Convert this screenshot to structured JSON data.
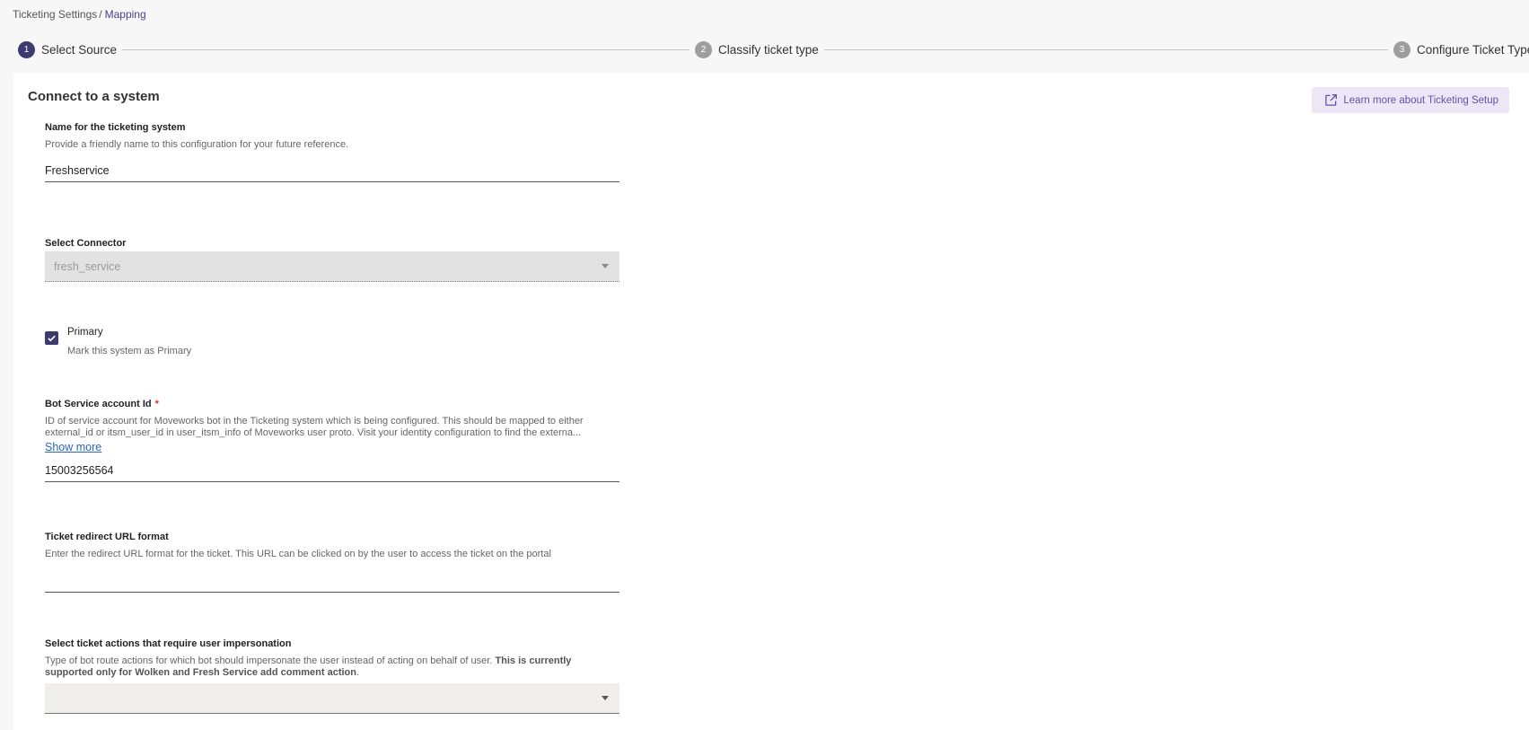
{
  "breadcrumb": {
    "parent": "Ticketing Settings",
    "separator": "/",
    "current": "Mapping"
  },
  "stepper": {
    "steps": [
      {
        "number": "1",
        "label": "Select Source",
        "active": true
      },
      {
        "number": "2",
        "label": "Classify ticket type",
        "active": false
      },
      {
        "number": "3",
        "label": "Configure Ticket Type",
        "active": false
      }
    ]
  },
  "card": {
    "title": "Connect to a system",
    "learn_more": {
      "label": "Learn more about Ticketing Setup",
      "icon": "external-link-icon"
    }
  },
  "fields": {
    "name": {
      "label": "Name for the ticketing system",
      "help": "Provide a friendly name to this configuration for your future reference.",
      "value": "Freshservice"
    },
    "connector": {
      "label": "Select Connector",
      "value": "fresh_service",
      "disabled": true
    },
    "primary": {
      "label": "Primary",
      "help": "Mark this system as Primary",
      "checked": true
    },
    "bot_account": {
      "label": "Bot Service account Id",
      "required_mark": "*",
      "help": "ID of service account for Moveworks bot in the Ticketing system which is being configured. This should be mapped to either external_id or itsm_user_id in user_itsm_info of Moveworks user proto. Visit your identity configuration to find the externa...",
      "show_more": "Show more",
      "value": "15003256564"
    },
    "redirect_url": {
      "label": "Ticket redirect URL format",
      "help": "Enter the redirect URL format for the ticket. This URL can be clicked on by the user to access the ticket on the portal",
      "value": ""
    },
    "impersonation": {
      "label": "Select ticket actions that require user impersonation",
      "help_plain": "Type of bot route actions for which bot should impersonate the user instead of acting on behalf of user.",
      "help_bold": "This is currently supported only for Wolken and Fresh Service add comment action",
      "help_end": ".",
      "value": ""
    }
  },
  "colors": {
    "accent": "#3c3a6e",
    "link": "#2a66c0",
    "learn_bg": "#ede6f7",
    "learn_text": "#6a4ea8",
    "required": "#d0342c"
  }
}
